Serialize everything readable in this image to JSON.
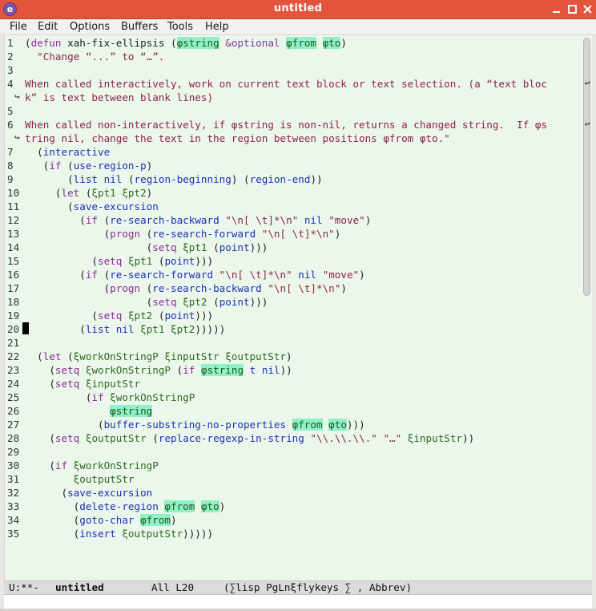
{
  "window": {
    "title": "untitled"
  },
  "menu": [
    "File",
    "Edit",
    "Options",
    "Buffers",
    "Tools",
    "Help"
  ],
  "lines": [
    {
      "n": "1",
      "segs": [
        [
          "plain",
          "("
        ],
        [
          "kw",
          "defun"
        ],
        [
          "plain",
          " xah-fix-ellipsis ("
        ],
        [
          "hl",
          "φstring"
        ],
        [
          "plain",
          " "
        ],
        [
          "opt",
          "&optional"
        ],
        [
          "plain",
          " "
        ],
        [
          "hl",
          "φfrom"
        ],
        [
          "plain",
          " "
        ],
        [
          "hl",
          "φto"
        ],
        [
          "plain",
          ")"
        ]
      ]
    },
    {
      "n": "2",
      "segs": [
        [
          "doc",
          "  \"Change “...” to “…”."
        ]
      ]
    },
    {
      "n": "3",
      "segs": []
    },
    {
      "n": "4",
      "segs": [
        [
          "doc",
          "When called interactively, work on current text block or text selection. (a “text bloc"
        ]
      ]
    },
    {
      "n": "",
      "segs": [
        [
          "doc",
          "k” is text between blank lines)"
        ]
      ]
    },
    {
      "n": "5",
      "segs": []
    },
    {
      "n": "6",
      "segs": [
        [
          "doc",
          "When called non-interactively, if φstring is non-nil, returns a changed string.  If φs"
        ]
      ]
    },
    {
      "n": "",
      "segs": [
        [
          "doc",
          "tring nil, change the text in the region between positions φfrom φto.\""
        ]
      ]
    },
    {
      "n": "7",
      "segs": [
        [
          "plain",
          "  ("
        ],
        [
          "fn",
          "interactive"
        ]
      ]
    },
    {
      "n": "8",
      "segs": [
        [
          "plain",
          "   ("
        ],
        [
          "kw",
          "if"
        ],
        [
          "plain",
          " ("
        ],
        [
          "fn",
          "use-region-p"
        ],
        [
          "plain",
          ")"
        ]
      ]
    },
    {
      "n": "9",
      "segs": [
        [
          "plain",
          "       ("
        ],
        [
          "fn",
          "list"
        ],
        [
          "plain",
          " "
        ],
        [
          "fn",
          "nil"
        ],
        [
          "plain",
          " ("
        ],
        [
          "fn",
          "region-beginning"
        ],
        [
          "plain",
          ") ("
        ],
        [
          "fn",
          "region-end"
        ],
        [
          "plain",
          "))"
        ]
      ]
    },
    {
      "n": "10",
      "segs": [
        [
          "plain",
          "     ("
        ],
        [
          "kw",
          "let"
        ],
        [
          "plain",
          " ("
        ],
        [
          "var",
          "ξpt1 ξpt2"
        ],
        [
          "plain",
          ")"
        ]
      ]
    },
    {
      "n": "11",
      "segs": [
        [
          "plain",
          "       ("
        ],
        [
          "fn",
          "save-excursion"
        ]
      ]
    },
    {
      "n": "12",
      "segs": [
        [
          "plain",
          "         ("
        ],
        [
          "kw",
          "if"
        ],
        [
          "plain",
          " ("
        ],
        [
          "fn",
          "re-search-backward"
        ],
        [
          "plain",
          " "
        ],
        [
          "str",
          "\"\\n[ \\t]*\\n\""
        ],
        [
          "plain",
          " "
        ],
        [
          "fn",
          "nil"
        ],
        [
          "plain",
          " "
        ],
        [
          "str",
          "\"move\""
        ],
        [
          "plain",
          ")"
        ]
      ]
    },
    {
      "n": "13",
      "segs": [
        [
          "plain",
          "             ("
        ],
        [
          "kw",
          "progn"
        ],
        [
          "plain",
          " ("
        ],
        [
          "fn",
          "re-search-forward"
        ],
        [
          "plain",
          " "
        ],
        [
          "str",
          "\"\\n[ \\t]*\\n\""
        ],
        [
          "plain",
          ")"
        ]
      ]
    },
    {
      "n": "14",
      "segs": [
        [
          "plain",
          "                    ("
        ],
        [
          "kw",
          "setq"
        ],
        [
          "plain",
          " "
        ],
        [
          "var",
          "ξpt1"
        ],
        [
          "plain",
          " ("
        ],
        [
          "fn",
          "point"
        ],
        [
          "plain",
          ")))"
        ]
      ]
    },
    {
      "n": "15",
      "segs": [
        [
          "plain",
          "           ("
        ],
        [
          "kw",
          "setq"
        ],
        [
          "plain",
          " "
        ],
        [
          "var",
          "ξpt1"
        ],
        [
          "plain",
          " ("
        ],
        [
          "fn",
          "point"
        ],
        [
          "plain",
          ")))"
        ]
      ]
    },
    {
      "n": "16",
      "segs": [
        [
          "plain",
          "         ("
        ],
        [
          "kw",
          "if"
        ],
        [
          "plain",
          " ("
        ],
        [
          "fn",
          "re-search-forward"
        ],
        [
          "plain",
          " "
        ],
        [
          "str",
          "\"\\n[ \\t]*\\n\""
        ],
        [
          "plain",
          " "
        ],
        [
          "fn",
          "nil"
        ],
        [
          "plain",
          " "
        ],
        [
          "str",
          "\"move\""
        ],
        [
          "plain",
          ")"
        ]
      ]
    },
    {
      "n": "17",
      "segs": [
        [
          "plain",
          "             ("
        ],
        [
          "kw",
          "progn"
        ],
        [
          "plain",
          " ("
        ],
        [
          "fn",
          "re-search-backward"
        ],
        [
          "plain",
          " "
        ],
        [
          "str",
          "\"\\n[ \\t]*\\n\""
        ],
        [
          "plain",
          ")"
        ]
      ]
    },
    {
      "n": "18",
      "segs": [
        [
          "plain",
          "                    ("
        ],
        [
          "kw",
          "setq"
        ],
        [
          "plain",
          " "
        ],
        [
          "var",
          "ξpt2"
        ],
        [
          "plain",
          " ("
        ],
        [
          "fn",
          "point"
        ],
        [
          "plain",
          ")))"
        ]
      ]
    },
    {
      "n": "19",
      "segs": [
        [
          "plain",
          "           ("
        ],
        [
          "kw",
          "setq"
        ],
        [
          "plain",
          " "
        ],
        [
          "var",
          "ξpt2"
        ],
        [
          "plain",
          " ("
        ],
        [
          "fn",
          "point"
        ],
        [
          "plain",
          ")))"
        ]
      ]
    },
    {
      "n": "20",
      "segs": [
        [
          "plain",
          "         ("
        ],
        [
          "fn",
          "list"
        ],
        [
          "plain",
          " "
        ],
        [
          "fn",
          "nil"
        ],
        [
          "plain",
          " "
        ],
        [
          "var",
          "ξpt1 ξpt2"
        ],
        [
          "plain",
          ")))))"
        ]
      ]
    },
    {
      "n": "21",
      "segs": []
    },
    {
      "n": "22",
      "segs": [
        [
          "plain",
          "  ("
        ],
        [
          "kw",
          "let"
        ],
        [
          "plain",
          " ("
        ],
        [
          "var",
          "ξworkOnStringP ξinputStr ξoutputStr"
        ],
        [
          "plain",
          ")"
        ]
      ]
    },
    {
      "n": "23",
      "segs": [
        [
          "plain",
          "    ("
        ],
        [
          "kw",
          "setq"
        ],
        [
          "plain",
          " "
        ],
        [
          "var",
          "ξworkOnStringP"
        ],
        [
          "plain",
          " ("
        ],
        [
          "kw",
          "if"
        ],
        [
          "plain",
          " "
        ],
        [
          "hl",
          "φstring"
        ],
        [
          "plain",
          " "
        ],
        [
          "fn",
          "t"
        ],
        [
          "plain",
          " "
        ],
        [
          "fn",
          "nil"
        ],
        [
          "plain",
          "))"
        ]
      ]
    },
    {
      "n": "24",
      "segs": [
        [
          "plain",
          "    ("
        ],
        [
          "kw",
          "setq"
        ],
        [
          "plain",
          " "
        ],
        [
          "var",
          "ξinputStr"
        ]
      ]
    },
    {
      "n": "25",
      "segs": [
        [
          "plain",
          "          ("
        ],
        [
          "kw",
          "if"
        ],
        [
          "plain",
          " "
        ],
        [
          "var",
          "ξworkOnStringP"
        ]
      ]
    },
    {
      "n": "26",
      "segs": [
        [
          "plain",
          "              "
        ],
        [
          "hl",
          "φstring"
        ]
      ]
    },
    {
      "n": "27",
      "segs": [
        [
          "plain",
          "            ("
        ],
        [
          "fn",
          "buffer-substring-no-properties"
        ],
        [
          "plain",
          " "
        ],
        [
          "hl",
          "φfrom"
        ],
        [
          "plain",
          " "
        ],
        [
          "hl",
          "φto"
        ],
        [
          "plain",
          ")))"
        ]
      ]
    },
    {
      "n": "28",
      "segs": [
        [
          "plain",
          "    ("
        ],
        [
          "kw",
          "setq"
        ],
        [
          "plain",
          " "
        ],
        [
          "var",
          "ξoutputStr"
        ],
        [
          "plain",
          " ("
        ],
        [
          "fn",
          "replace-regexp-in-string"
        ],
        [
          "plain",
          " "
        ],
        [
          "str",
          "\"\\\\.\\\\.\\\\.\""
        ],
        [
          "plain",
          " "
        ],
        [
          "str",
          "\"…\""
        ],
        [
          "plain",
          " "
        ],
        [
          "var",
          "ξinputStr"
        ],
        [
          "plain",
          "))"
        ]
      ]
    },
    {
      "n": "29",
      "segs": []
    },
    {
      "n": "30",
      "segs": [
        [
          "plain",
          "    ("
        ],
        [
          "kw",
          "if"
        ],
        [
          "plain",
          " "
        ],
        [
          "var",
          "ξworkOnStringP"
        ]
      ]
    },
    {
      "n": "31",
      "segs": [
        [
          "plain",
          "        "
        ],
        [
          "var",
          "ξoutputStr"
        ]
      ]
    },
    {
      "n": "32",
      "segs": [
        [
          "plain",
          "      ("
        ],
        [
          "fn",
          "save-excursion"
        ]
      ]
    },
    {
      "n": "33",
      "segs": [
        [
          "plain",
          "        ("
        ],
        [
          "fn",
          "delete-region"
        ],
        [
          "plain",
          " "
        ],
        [
          "hl",
          "φfrom"
        ],
        [
          "plain",
          " "
        ],
        [
          "hl",
          "φto"
        ],
        [
          "plain",
          ")"
        ]
      ]
    },
    {
      "n": "34",
      "segs": [
        [
          "plain",
          "        ("
        ],
        [
          "fn",
          "goto-char"
        ],
        [
          "plain",
          " "
        ],
        [
          "hl",
          "φfrom"
        ],
        [
          "plain",
          ")"
        ]
      ]
    },
    {
      "n": "35",
      "segs": [
        [
          "plain",
          "        ("
        ],
        [
          "fn",
          "insert"
        ],
        [
          "plain",
          " "
        ],
        [
          "var",
          "ξoutputStr"
        ],
        [
          "plain",
          ")))))"
        ]
      ]
    }
  ],
  "modeline": {
    "status": "U:**-",
    "buffer": "untitled",
    "position": "All L20",
    "modes": "(∑lisp PgLnξflykeys ∑ , Abbrev)"
  }
}
